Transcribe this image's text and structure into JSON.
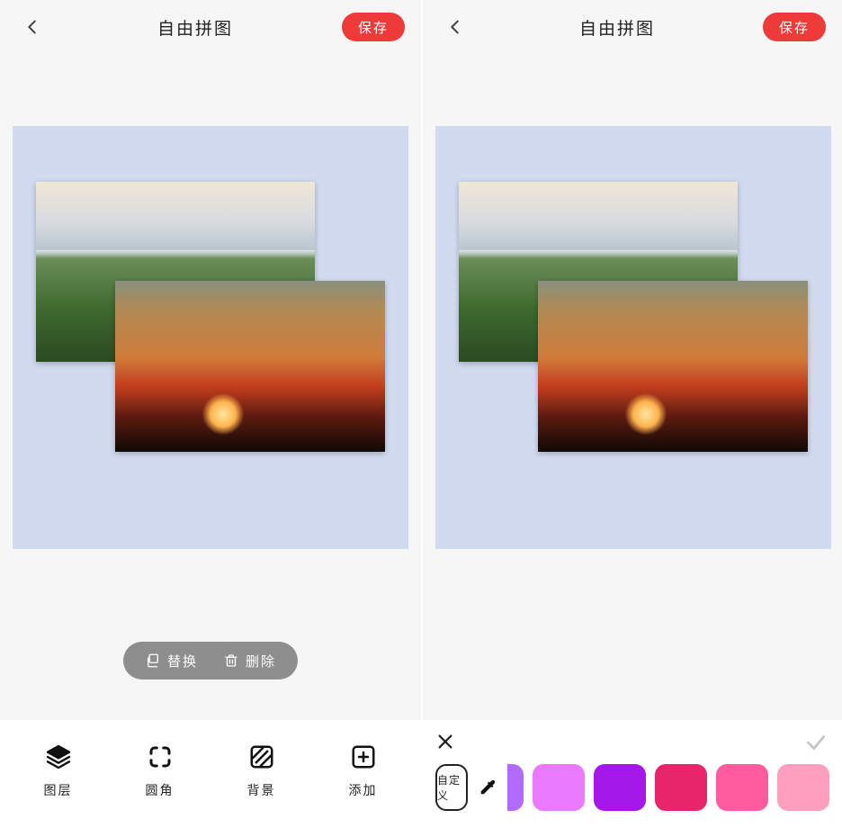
{
  "header": {
    "title": "自由拼图",
    "save_label": "保存"
  },
  "pill_actions": {
    "replace_label": "替换",
    "delete_label": "删除"
  },
  "toolbar": {
    "layers_label": "图层",
    "corner_label": "圆角",
    "background_label": "背景",
    "add_label": "添加"
  },
  "panel2": {
    "custom_label": "自定义",
    "swatches": [
      "#b36bff",
      "#e979ff",
      "#a318e8",
      "#e8256b",
      "#ff5b9e",
      "#ff9fbf"
    ]
  }
}
